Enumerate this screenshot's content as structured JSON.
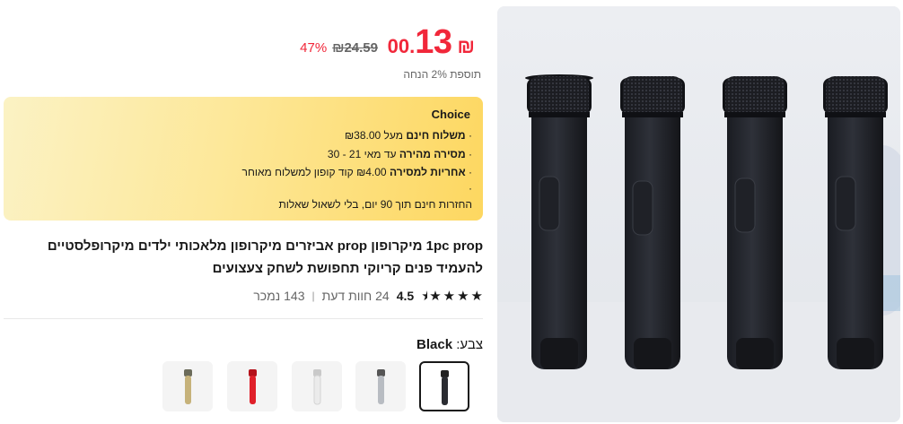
{
  "price": {
    "currency": "₪",
    "integer": "13",
    "decimal": ".00",
    "old_price": "₪24.59",
    "discount": "47%",
    "extra_discount": "תוספת 2% הנחה"
  },
  "choice": {
    "title": "Choice",
    "line1_bold": "משלוח חינם",
    "line1_rest": "מעל ₪38.00",
    "line2_bold": "מסירה מהירה",
    "line2_rest": "עד מאי 21 - 30",
    "line3_bold": "אחריות למסירה",
    "line3_rest": "₪4.00 קוד קופון למשלוח מאוחר",
    "line4": "החזרות חינם תוך 90 יום, בלי לשאול שאלות",
    "bullet": "·"
  },
  "product": {
    "title": "1pc prop מיקרופון prop אביזרים מיקרופון מלאכותי ילדים מיקרופלסטיים להעמיד פנים קריוקי תחפושת לשחק צעצועים"
  },
  "rating": {
    "score": "4.5",
    "reviews": "24 חוות דעת",
    "sold": "143 נמכר",
    "separator": "|",
    "star_count": 4.5
  },
  "color": {
    "label": "צבע:",
    "selected": "Black",
    "options": [
      "black",
      "silver",
      "white",
      "red",
      "gold"
    ]
  },
  "colors": {
    "price_red": "#f1273a",
    "choice_bg_start": "#fbf2c4",
    "choice_bg_end": "#fdd760"
  }
}
